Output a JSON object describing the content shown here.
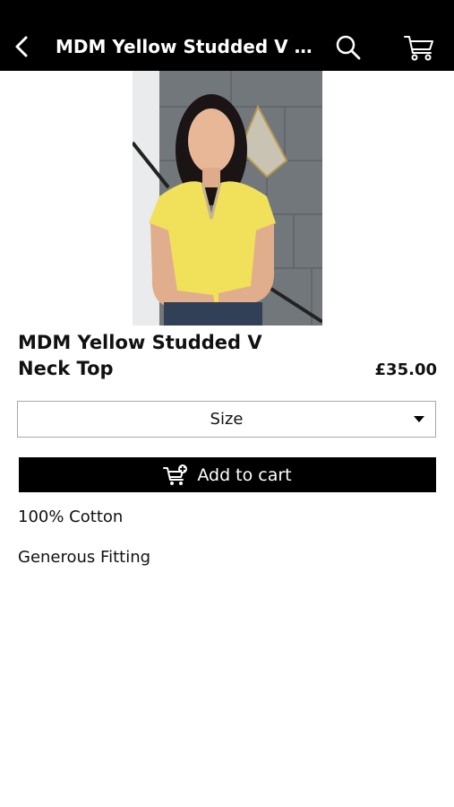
{
  "header": {
    "title": "MDM Yellow Studded V Neck Top"
  },
  "product": {
    "image_alt": "Woman wearing yellow studded v neck top",
    "name": "MDM Yellow Studded V Neck Top",
    "price": "£35.00",
    "size_label": "Size",
    "add_to_cart_label": "Add to cart",
    "description": [
      "100% Cotton",
      "Generous Fitting"
    ]
  },
  "colors": {
    "bar": "#000000",
    "top_yellow": "#f1e05a"
  }
}
